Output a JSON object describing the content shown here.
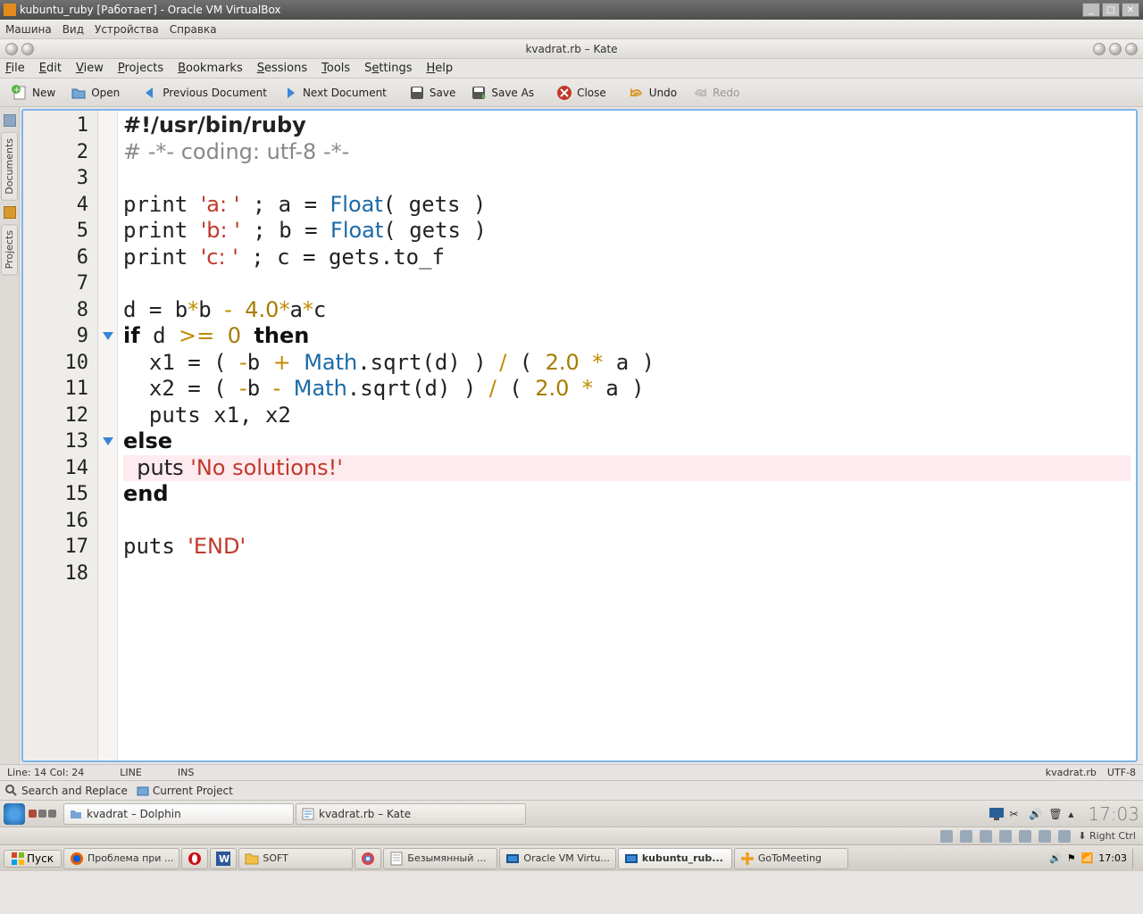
{
  "vb": {
    "title": "kubuntu_ruby [Работает] - Oracle VM VirtualBox",
    "menu": [
      "Машина",
      "Вид",
      "Устройства",
      "Справка"
    ],
    "status_text": "Right Ctrl"
  },
  "kate": {
    "title": "kvadrat.rb – Kate",
    "menubar": [
      {
        "label": "File",
        "u": "F"
      },
      {
        "label": "Edit",
        "u": "E"
      },
      {
        "label": "View",
        "u": "V"
      },
      {
        "label": "Projects",
        "u": "P"
      },
      {
        "label": "Bookmarks",
        "u": "B"
      },
      {
        "label": "Sessions",
        "u": "S"
      },
      {
        "label": "Tools",
        "u": "T"
      },
      {
        "label": "Settings",
        "u": "S"
      },
      {
        "label": "Help",
        "u": "H"
      }
    ],
    "toolbar": {
      "new": "New",
      "open": "Open",
      "prev": "Previous Document",
      "next": "Next Document",
      "save": "Save",
      "saveas": "Save As",
      "close": "Close",
      "undo": "Undo",
      "redo": "Redo"
    },
    "side_tabs": [
      "Documents",
      "Projects"
    ],
    "status": {
      "pos": "Line: 14 Col: 24",
      "line_mode": "LINE",
      "ins": "INS",
      "filename": "kvadrat.rb",
      "encoding": "UTF-8",
      "search": "Search and Replace",
      "project": "Current Project"
    },
    "code": {
      "line_count": 18,
      "fold_lines": [
        9,
        13
      ],
      "highlight_line": 14
    }
  },
  "kde": {
    "tasks": [
      {
        "label": "kvadrat – Dolphin",
        "icon": "folder"
      },
      {
        "label": "kvadrat.rb – Kate",
        "icon": "kate"
      }
    ],
    "clock": "17:03"
  },
  "win": {
    "start": "Пуск",
    "tasks": [
      {
        "label": "Проблема при ...",
        "icon": "firefox"
      },
      {
        "label": "",
        "icon": "opera",
        "icon_only": true
      },
      {
        "label": "",
        "icon": "word",
        "icon_only": true
      },
      {
        "label": "SOFT",
        "icon": "folder"
      },
      {
        "label": "",
        "icon": "chrome",
        "icon_only": true
      },
      {
        "label": "Безымянный ...",
        "icon": "notepad"
      },
      {
        "label": "Oracle VM Virtu...",
        "icon": "vbox"
      },
      {
        "label": "kubuntu_rub...",
        "icon": "vbox",
        "active": true
      },
      {
        "label": "GoToMeeting",
        "icon": "flower"
      }
    ],
    "clock": "17:03"
  }
}
